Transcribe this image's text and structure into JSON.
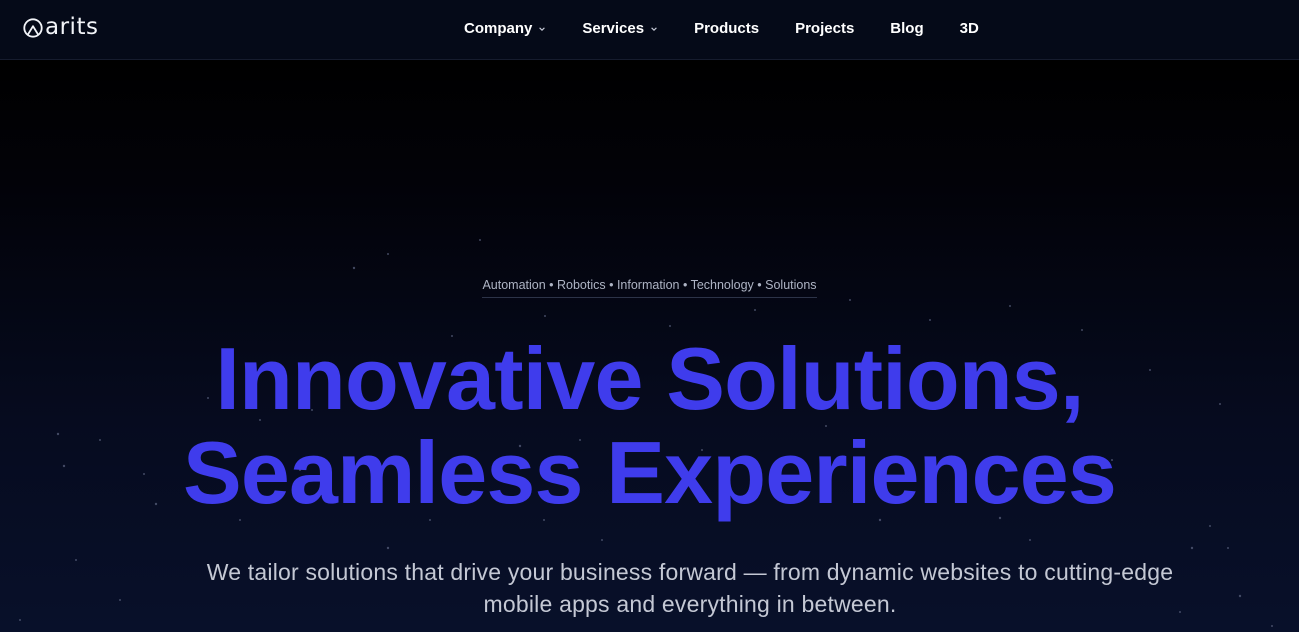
{
  "header": {
    "logo_text": "arits",
    "nav": [
      {
        "label": "Company",
        "has_dropdown": true
      },
      {
        "label": "Services",
        "has_dropdown": true
      },
      {
        "label": "Products",
        "has_dropdown": false
      },
      {
        "label": "Projects",
        "has_dropdown": false
      },
      {
        "label": "Blog",
        "has_dropdown": false
      },
      {
        "label": "3D",
        "has_dropdown": false
      }
    ]
  },
  "hero": {
    "tagline": "Automation • Robotics • Information • Technology • Solutions",
    "headline_line1": "Innovative Solutions,",
    "headline_line2": "Seamless Experiences",
    "subtext": "We tailor solutions that drive your business forward — from dynamic websites to cutting-edge mobile apps and everything in between."
  },
  "colors": {
    "accent": "#3f3cec",
    "header_bg": "#050a18",
    "page_bg": "#000000",
    "text": "#ffffff",
    "muted_text": "#c4c8d4"
  },
  "icons": {
    "logo": "arits-logo-icon",
    "dropdown": "chevron-down-icon"
  }
}
